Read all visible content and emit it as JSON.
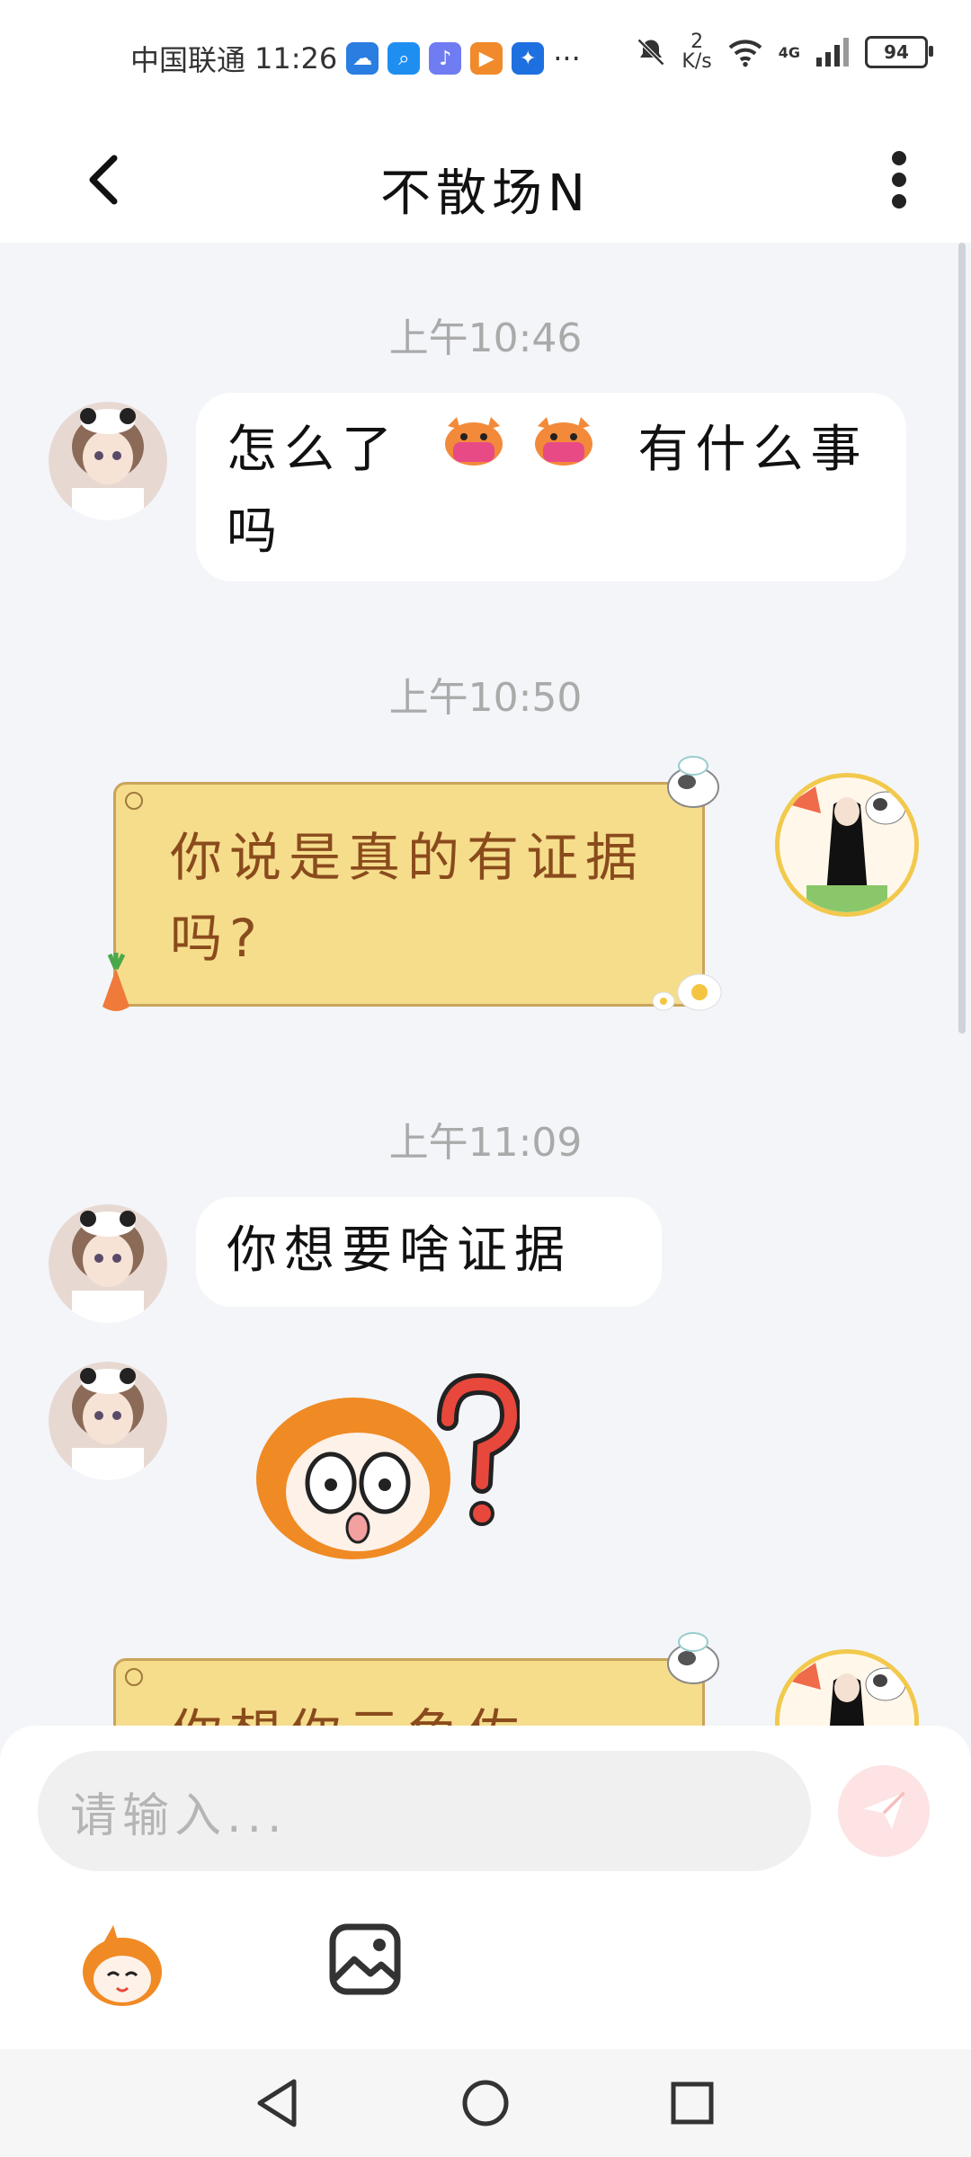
{
  "status_bar": {
    "carrier": "中国联通",
    "time": "11:26",
    "more": "···",
    "net_speed_value": "2",
    "net_speed_unit": "K/s",
    "signal_label": "4G",
    "battery": "94",
    "app_icons": [
      "weather-app-icon",
      "search-app-icon",
      "music-app-icon",
      "video-app-icon",
      "idea-app-icon"
    ]
  },
  "header": {
    "title": "不散场N"
  },
  "messages": [
    {
      "type": "timestamp",
      "text": "上午10:46"
    },
    {
      "type": "incoming_text",
      "text_before": "怎么了",
      "emoji": [
        "cat-mask-emoji",
        "cat-mask-emoji"
      ],
      "text_after": "有什么事吗"
    },
    {
      "type": "timestamp",
      "text": "上午10:50"
    },
    {
      "type": "outgoing_note",
      "text": "你说是真的有证据吗?"
    },
    {
      "type": "timestamp",
      "text": "上午11:09"
    },
    {
      "type": "incoming_text",
      "text": "你想要啥证据"
    },
    {
      "type": "incoming_sticker",
      "sticker": "confused-question-sticker"
    },
    {
      "type": "outgoing_note",
      "text": "你想你元鱼佐"
    }
  ],
  "input": {
    "placeholder": "请输入..."
  },
  "colors": {
    "background": "#f3f5f9",
    "note_bubble": "#f5dd8c",
    "note_text": "#8a4b1c",
    "send_button": "#fde3e3"
  }
}
